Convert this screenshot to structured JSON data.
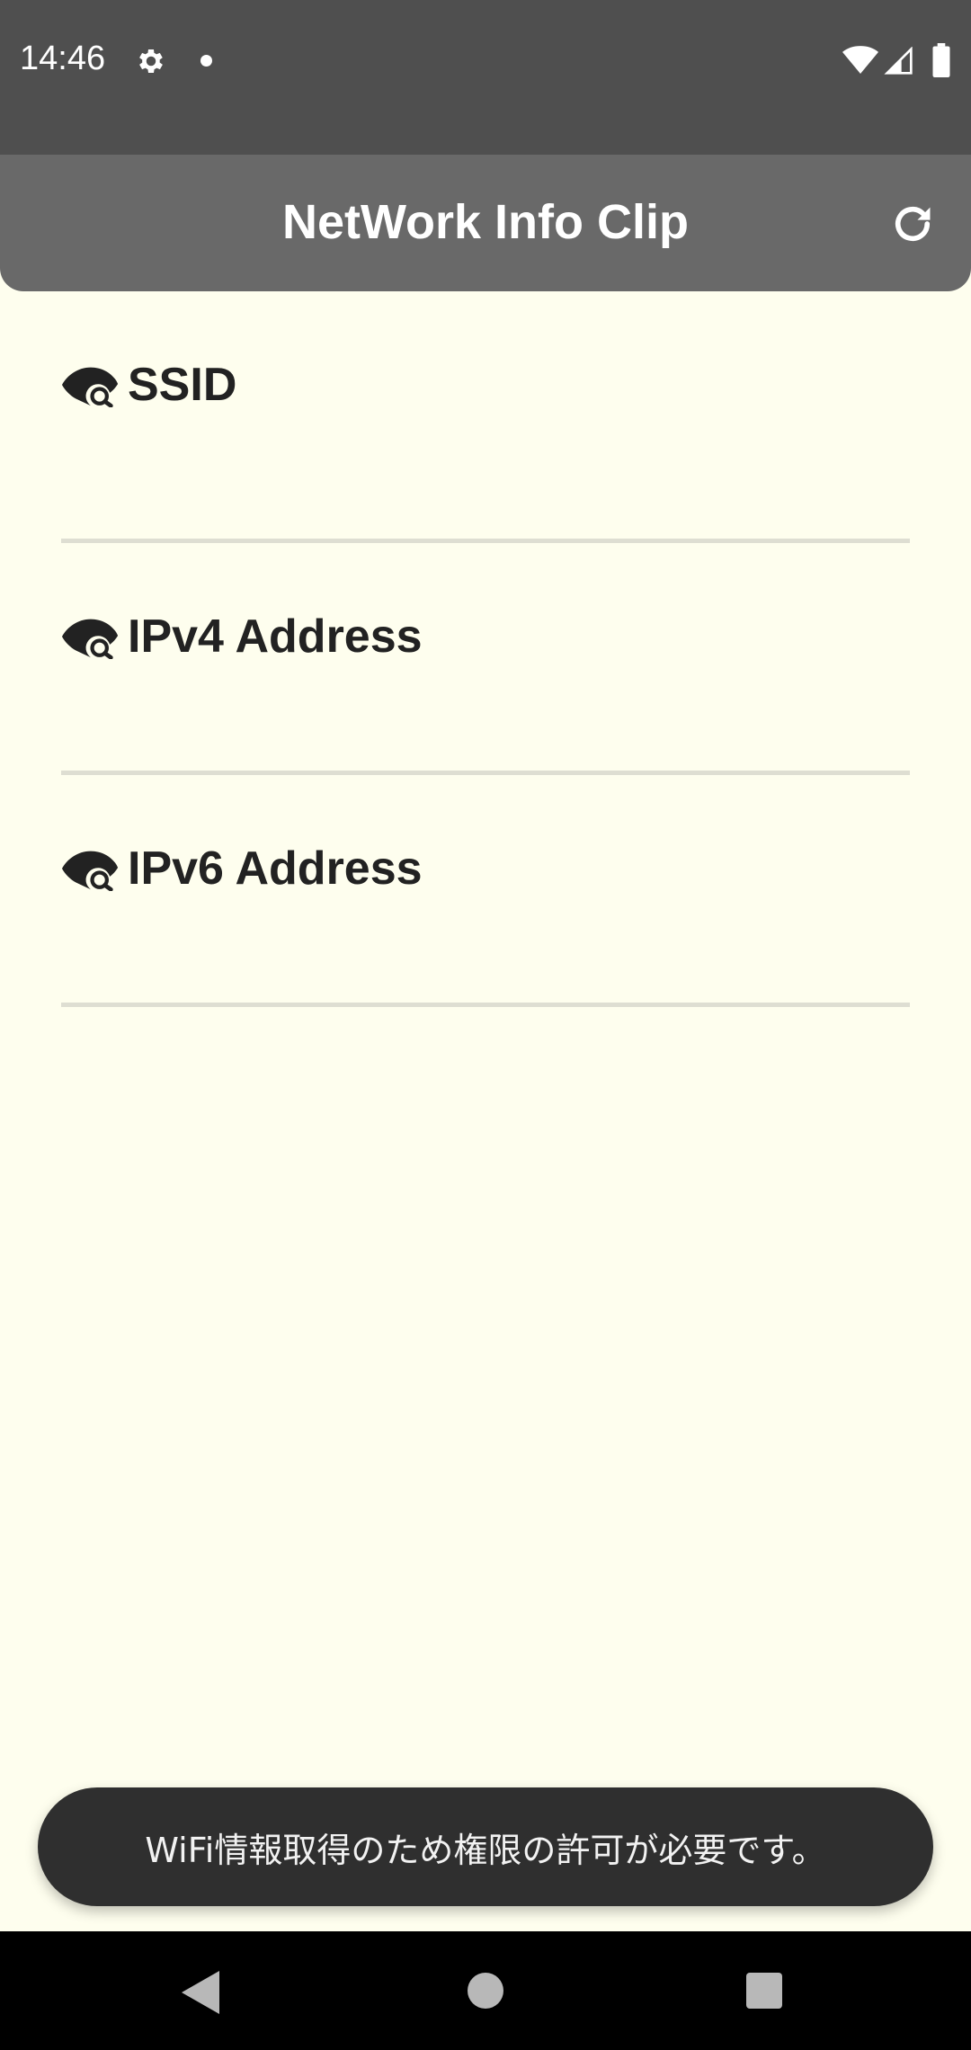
{
  "status_bar": {
    "time": "14:46",
    "icons": [
      "gear-icon",
      "notification-dot-icon",
      "wifi-icon",
      "signal-icon",
      "battery-icon"
    ]
  },
  "app_bar": {
    "title": "NetWork Info Clip",
    "action_icon": "refresh-icon"
  },
  "items": [
    {
      "label": "SSID",
      "value": "",
      "icon": "eye-search-icon"
    },
    {
      "label": "IPv4 Address",
      "value": "",
      "icon": "eye-search-icon"
    },
    {
      "label": "IPv6 Address",
      "value": "",
      "icon": "eye-search-icon"
    }
  ],
  "snackbar": {
    "message": "WiFi情報取得のため権限の許可が必要です。"
  },
  "nav_bar": {
    "buttons": [
      "back-icon",
      "home-icon",
      "recents-icon"
    ]
  },
  "colors": {
    "background": "#fefeee",
    "status_bar": "#4f4f4f",
    "app_bar": "#696969",
    "divider": "#deded2",
    "snackbar": "#2f2f2f"
  }
}
